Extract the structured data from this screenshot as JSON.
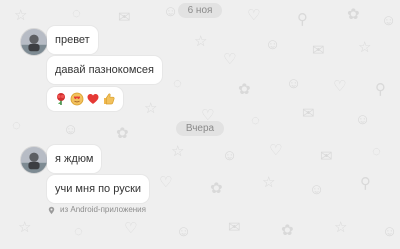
{
  "chat": {
    "date_separators": [
      {
        "label": "6 ноя"
      },
      {
        "label": "Вчера"
      }
    ],
    "messages": [
      {
        "text": "превет"
      },
      {
        "text": "давай пазнокомсея"
      },
      {
        "emoji_names": [
          "rose-emoji",
          "face-with-hearts-emoji",
          "heart-emoji",
          "thumbs-up-emoji"
        ]
      },
      {
        "text": "я ждюм"
      },
      {
        "text": "учи мня по руски"
      }
    ],
    "source_note": "из Android-приложения"
  },
  "colors": {
    "background": "#efefef",
    "bubble": "#ffffff",
    "text": "#333333",
    "muted_text": "#8d8d8d",
    "date_pill": "#e2e2e2",
    "heart": "#e53935",
    "rose": "#d32f2f",
    "thumb": "#f2c15d"
  }
}
